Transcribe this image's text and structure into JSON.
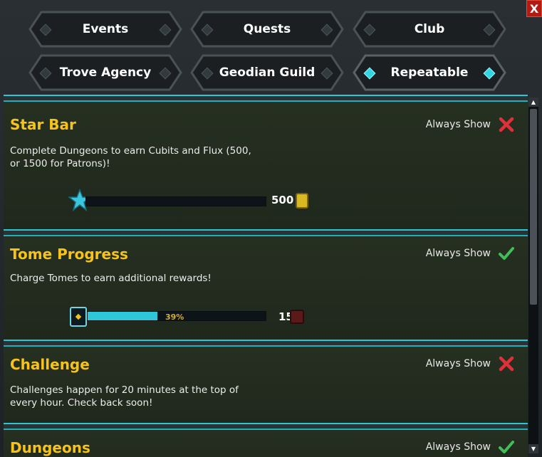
{
  "close_label": "X",
  "tabs": [
    {
      "label": "Events",
      "active": false
    },
    {
      "label": "Quests",
      "active": false
    },
    {
      "label": "Club",
      "active": false
    },
    {
      "label": "Trove Agency",
      "active": false
    },
    {
      "label": "Geodian Guild",
      "active": false
    },
    {
      "label": "Repeatable",
      "active": true
    }
  ],
  "sections": {
    "star_bar": {
      "title": "Star Bar",
      "always_show": "Always Show",
      "always_show_enabled": false,
      "description": "Complete Dungeons to earn Cubits and Flux (500, or 1500 for Patrons)!",
      "progress": 0.0,
      "reward_value": "500",
      "reward_icon": "cubit-icon"
    },
    "tome_progress": {
      "title": "Tome Progress",
      "always_show": "Always Show",
      "always_show_enabled": true,
      "description": "Charge Tomes to earn additional rewards!",
      "progress": 0.39,
      "progress_label": "39%",
      "reward_value": "15",
      "reward_icon": "tome-reward-icon"
    },
    "challenge": {
      "title": "Challenge",
      "always_show": "Always Show",
      "always_show_enabled": false,
      "description": "Challenges happen for 20 minutes at the top of every hour.  Check back soon!"
    },
    "dungeons": {
      "title": "Dungeons",
      "always_show": "Always Show",
      "always_show_enabled": true
    }
  },
  "colors": {
    "accent": "#29c6d3",
    "title": "#f7c21a",
    "cross": "#e0303a",
    "check": "#3fbf57"
  }
}
